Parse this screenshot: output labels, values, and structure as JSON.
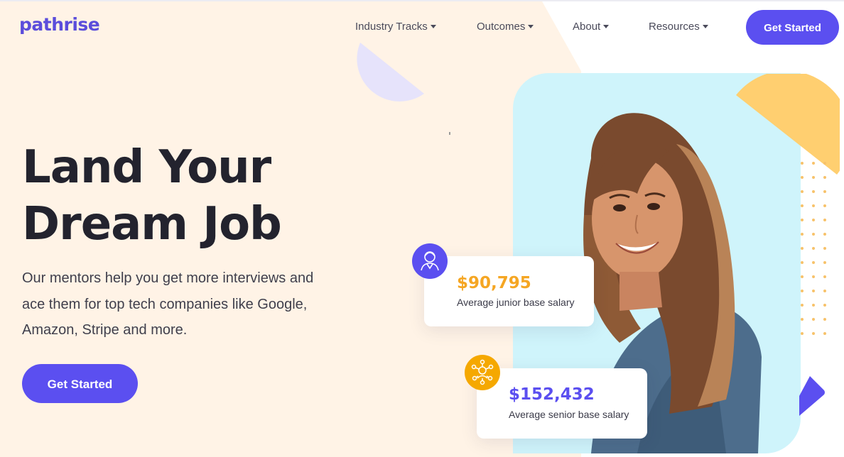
{
  "brand": {
    "logo_text": "pathrise",
    "primary_color": "#5b4ff0",
    "accent_yellow": "#f7c26a",
    "accent_orange": "#f5a623",
    "cream_bg": "#fff3e6",
    "photo_bg": "#cff4fb"
  },
  "nav": {
    "items": [
      {
        "label": "Industry Tracks",
        "has_dropdown": true
      },
      {
        "label": "Outcomes",
        "has_dropdown": true
      },
      {
        "label": "About",
        "has_dropdown": true
      },
      {
        "label": "Resources",
        "has_dropdown": true
      }
    ],
    "cta_label": "Get Started"
  },
  "hero": {
    "headline_line1": "Land Your",
    "headline_line2": "Dream Job",
    "subtext": "Our mentors help you get more interviews and ace them for top tech companies like Google, Amazon, Stripe and more.",
    "cta_label": "Get Started"
  },
  "stats": [
    {
      "value": "$90,795",
      "label": "Average junior base salary",
      "icon": "person-icon"
    },
    {
      "value": "$152,432",
      "label": "Average senior base salary",
      "icon": "team-network-icon"
    }
  ]
}
